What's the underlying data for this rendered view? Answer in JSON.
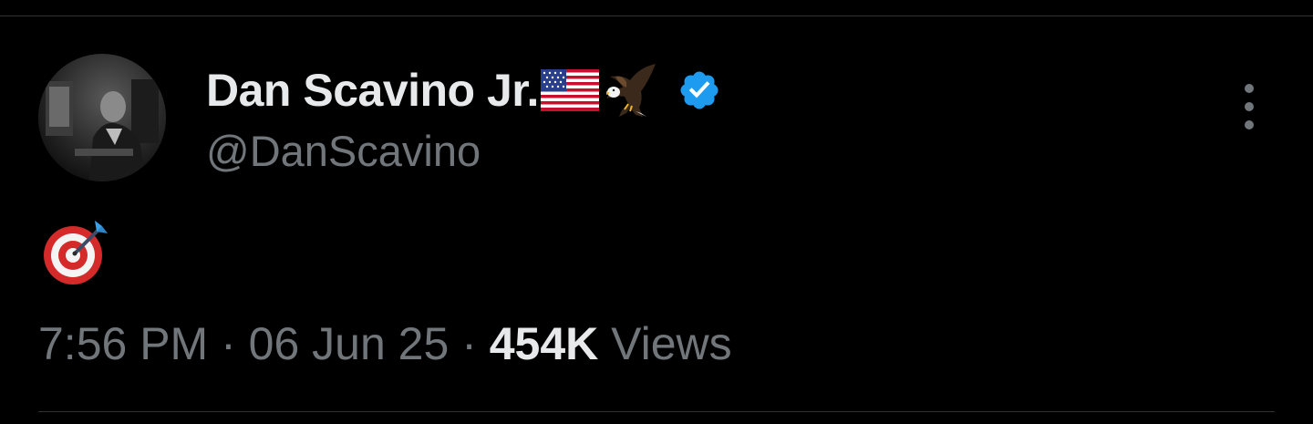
{
  "tweet": {
    "author": {
      "display_name": "Dan Scavino Jr.",
      "name_emojis": [
        "us-flag-icon",
        "eagle-icon"
      ],
      "verified": true,
      "handle": "@DanScavino"
    },
    "body_emoji": "direct-hit-target-icon",
    "meta": {
      "time": "7:56 PM",
      "sep1": " · ",
      "date": "06 Jun 25",
      "sep2": " · ",
      "views_count": "454K",
      "views_label": " Views"
    }
  },
  "colors": {
    "background": "#000000",
    "primary_text": "#e7e9ea",
    "secondary_text": "#71767b",
    "verified_badge": "#1d9bf0",
    "divider": "#2f3336"
  }
}
